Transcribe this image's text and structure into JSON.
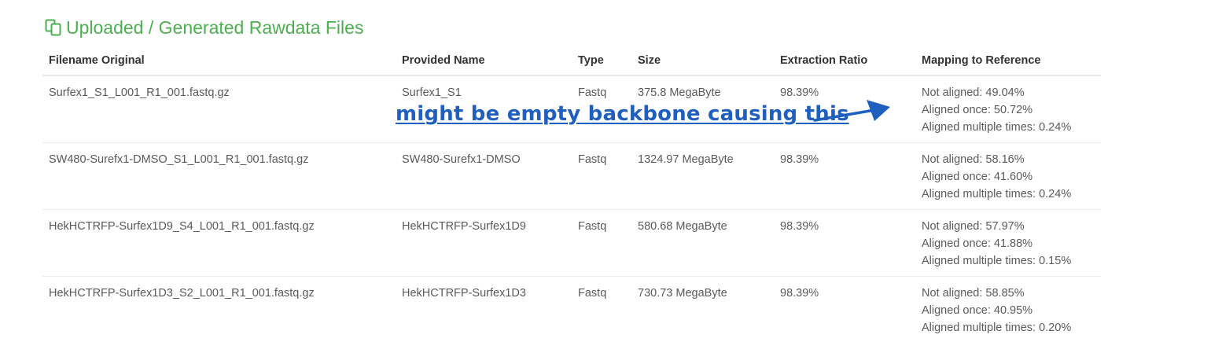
{
  "section": {
    "title": "Uploaded / Generated Rawdata Files",
    "icon": "copy-files-icon",
    "accent_color": "#4caf50"
  },
  "table": {
    "headers": {
      "filename": "Filename Original",
      "provided": "Provided Name",
      "type": "Type",
      "size": "Size",
      "ratio": "Extraction Ratio",
      "mapping": "Mapping to Reference"
    },
    "rows": [
      {
        "filename": "Surfex1_S1_L001_R1_001.fastq.gz",
        "provided": "Surfex1_S1",
        "type": "Fastq",
        "size": "375.8 MegaByte",
        "ratio": "98.39%",
        "not_aligned": "Not aligned: 49.04%",
        "aligned_once": "Aligned once: 50.72%",
        "aligned_multi": "Aligned multiple times: 0.24%"
      },
      {
        "filename": "SW480-Surefx1-DMSO_S1_L001_R1_001.fastq.gz",
        "provided": "SW480-Surefx1-DMSO",
        "type": "Fastq",
        "size": "1324.97 MegaByte",
        "ratio": "98.39%",
        "not_aligned": "Not aligned: 58.16%",
        "aligned_once": "Aligned once: 41.60%",
        "aligned_multi": "Aligned multiple times: 0.24%"
      },
      {
        "filename": "HekHCTRFP-Surfex1D9_S4_L001_R1_001.fastq.gz",
        "provided": "HekHCTRFP-Surfex1D9",
        "type": "Fastq",
        "size": "580.68 MegaByte",
        "ratio": "98.39%",
        "not_aligned": "Not aligned: 57.97%",
        "aligned_once": "Aligned once: 41.88%",
        "aligned_multi": "Aligned multiple times: 0.15%"
      },
      {
        "filename": "HekHCTRFP-Surfex1D3_S2_L001_R1_001.fastq.gz",
        "provided": "HekHCTRFP-Surfex1D3",
        "type": "Fastq",
        "size": "730.73 MegaByte",
        "ratio": "98.39%",
        "not_aligned": "Not aligned: 58.85%",
        "aligned_once": "Aligned once: 40.95%",
        "aligned_multi": "Aligned multiple times: 0.20%"
      }
    ]
  },
  "annotation": {
    "text": "might be empty backbone causing this",
    "color": "#1f5fbf",
    "arrow_icon": "arrow-right-icon"
  }
}
